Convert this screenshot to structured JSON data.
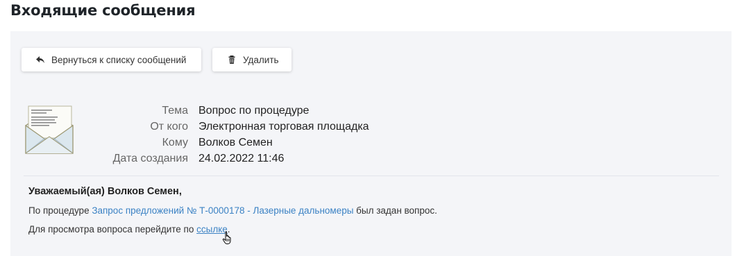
{
  "page": {
    "title": "Входящие сообщения"
  },
  "toolbar": {
    "back_label": "Вернуться к списку сообщений",
    "delete_label": "Удалить",
    "back_icon": "reply-arrow-icon",
    "delete_icon": "trash-icon"
  },
  "envelope_icon": "open-envelope-icon",
  "message": {
    "fields": [
      {
        "label": "Тема",
        "value": "Вопрос по процедуре"
      },
      {
        "label": "От кого",
        "value": "Электронная торговая площадка"
      },
      {
        "label": "Кому",
        "value": "Волков Семен"
      },
      {
        "label": "Дата создания",
        "value": "24.02.2022 11:46"
      }
    ],
    "greeting": "Уважаемый(ая) Волков Семен,",
    "line1_prefix": "По процедуре ",
    "line1_link": "Запрос предложений № Т-0000178 - Лазерные дальномеры",
    "line1_suffix": " был задан вопрос.",
    "line2_prefix": "Для просмотра вопроса перейдите по ",
    "line2_link": "ссылке",
    "line2_suffix": "."
  },
  "colors": {
    "panel_bg": "#f4f5f8",
    "link": "#3b82c4",
    "title": "#1f2429"
  }
}
